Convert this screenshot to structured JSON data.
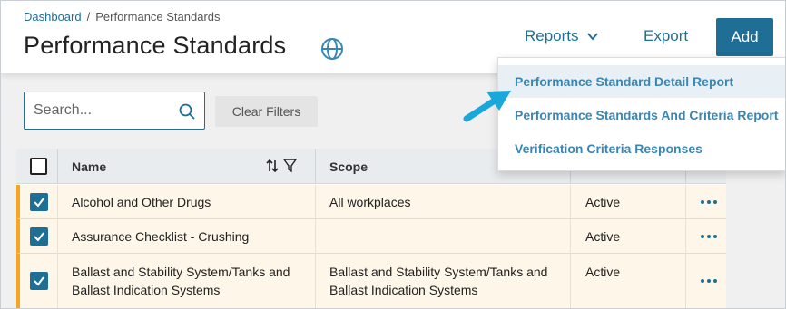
{
  "breadcrumb": {
    "home": "Dashboard",
    "separator": "/",
    "current": "Performance Standards"
  },
  "page": {
    "title": "Performance Standards"
  },
  "header_actions": {
    "reports_label": "Reports",
    "export_label": "Export",
    "add_label": "Add"
  },
  "filters": {
    "search_placeholder": "Search...",
    "clear_label": "Clear Filters"
  },
  "table": {
    "columns": [
      "Name",
      "Scope"
    ],
    "rows": [
      {
        "name": "Alcohol and Other Drugs",
        "scope": "All workplaces",
        "status": "Active"
      },
      {
        "name": "Assurance Checklist - Crushing",
        "scope": "",
        "status": "Active"
      },
      {
        "name_line1": "Ballast and Stability System/Tanks and",
        "name_line2": "Ballast Indication Systems",
        "scope_line1": "Ballast and Stability System/Tanks and",
        "scope_line2": "Ballast Indication Systems",
        "status": "Active"
      }
    ]
  },
  "reports_menu": {
    "items": [
      "Performance Standard Detail Report",
      "Performance Standards And Criteria Report",
      "Verification Criteria Responses"
    ]
  },
  "colors": {
    "primary": "#1f6e96",
    "link": "#3a86b3",
    "row_highlight": "#fef6e8",
    "row_accent": "#f5a623",
    "arrow": "#1aa7d9"
  },
  "icons": {
    "globe": "globe-icon",
    "chevron": "chevron-down-icon",
    "search": "search-icon",
    "sort": "sort-icon",
    "filter": "filter-icon",
    "more": "more-options-icon",
    "check": "checkmark-icon"
  }
}
